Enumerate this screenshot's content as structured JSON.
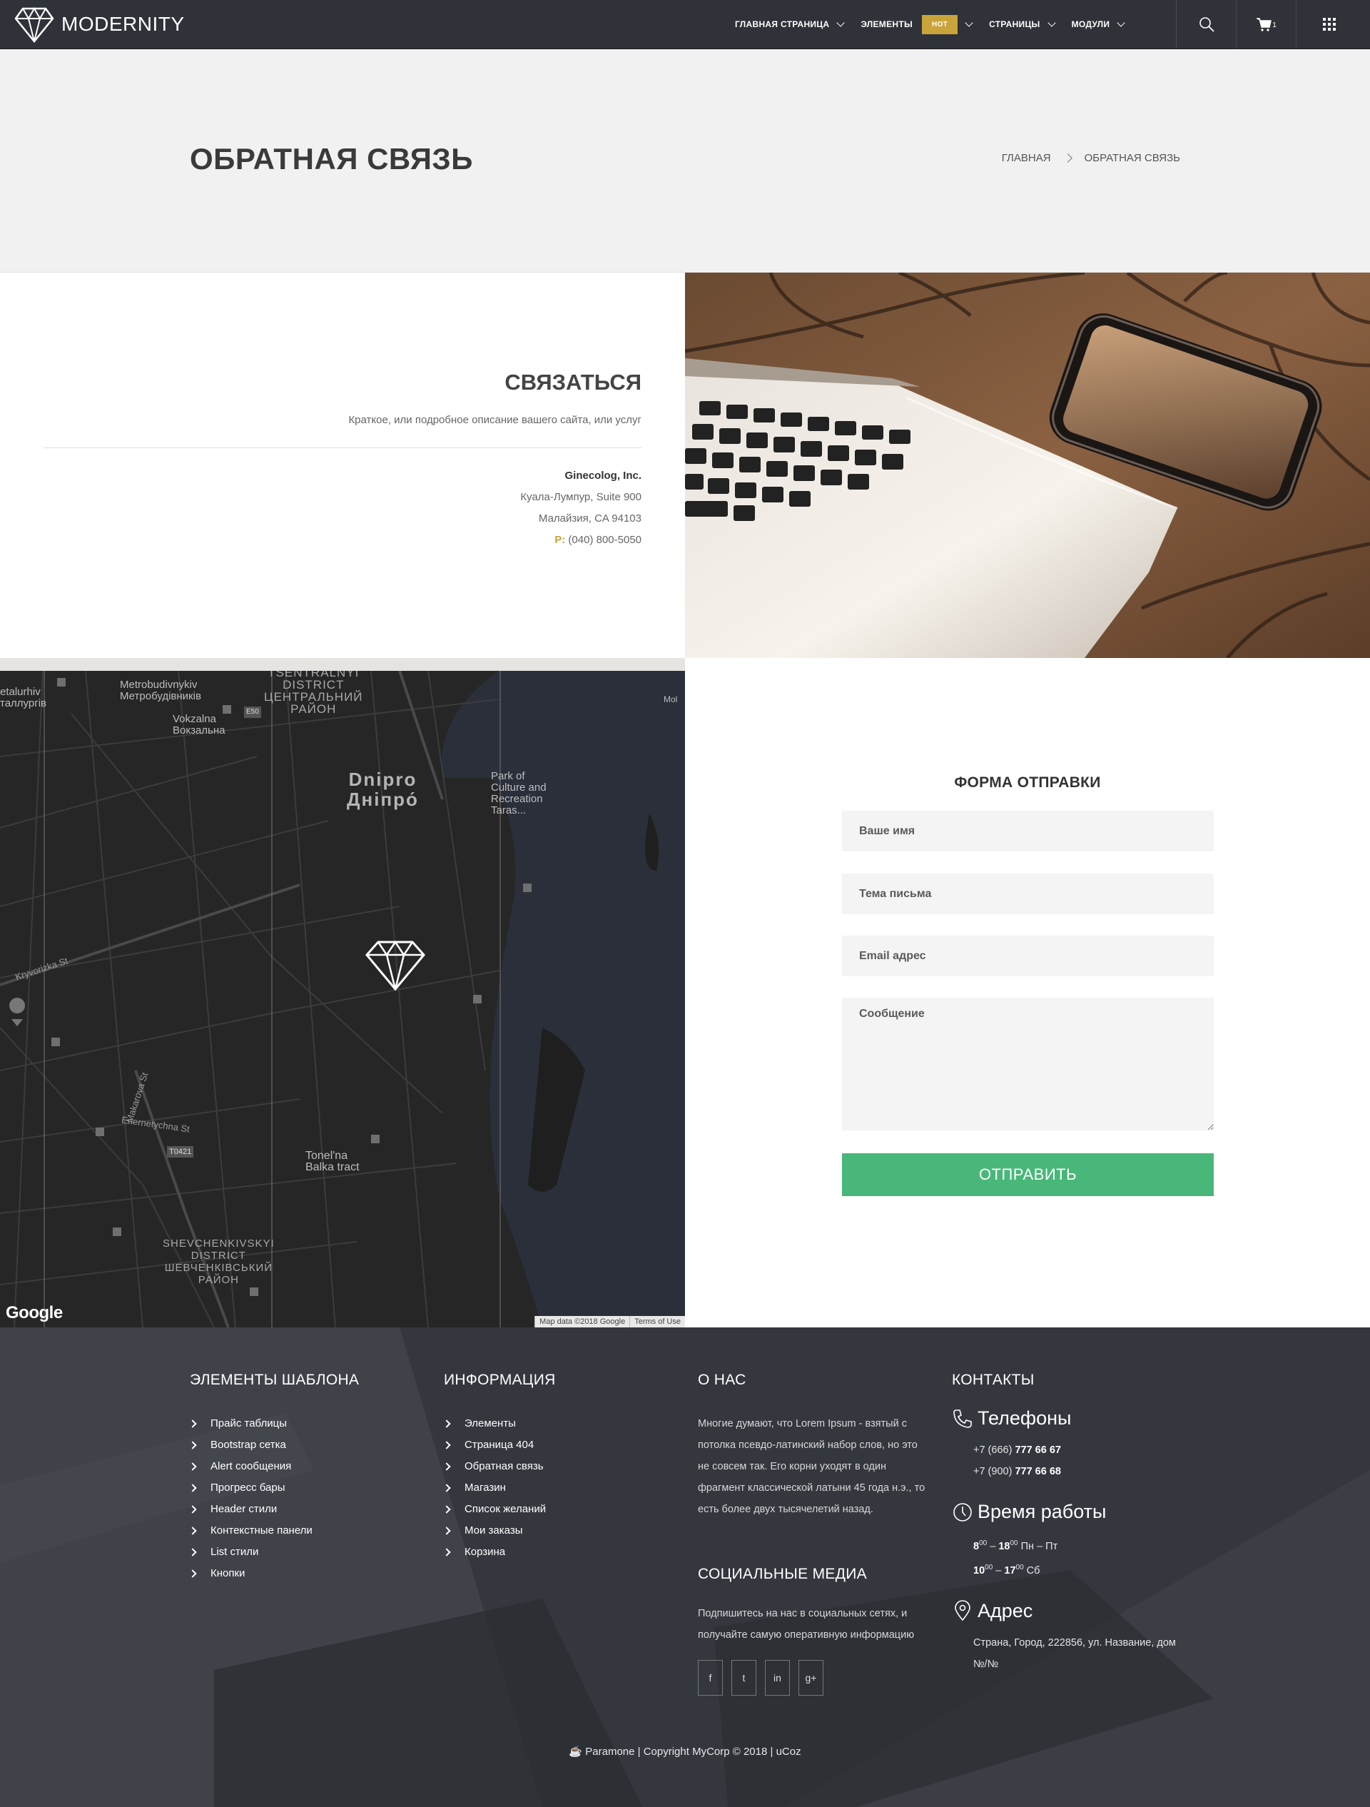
{
  "header": {
    "logo_text": "MODERNITY",
    "nav": [
      {
        "label": "ГЛАВНАЯ СТРАНИЦА"
      },
      {
        "label": "ЭЛЕМЕНТЫ",
        "badge": "HOT"
      },
      {
        "label": "СТРАНИЦЫ"
      },
      {
        "label": "МОДУЛИ"
      }
    ],
    "cart_count": "1",
    "icons": [
      "search-icon",
      "cart-icon",
      "grid-menu-icon"
    ]
  },
  "titlebar": {
    "title": "ОБРАТНАЯ СВЯЗЬ",
    "breadcrumb": [
      "ГЛАВНАЯ",
      "ОБРАТНАЯ СВЯЗЬ"
    ]
  },
  "contact": {
    "heading": "СВЯЗАТЬСЯ",
    "description": "Краткое, или подробное описание вашего сайта, или услуг",
    "company": "Ginecolog, Inc.",
    "address1": "Куала-Лумпур, Suite 900",
    "address2": "Малайзия, CA 94103",
    "phone_prefix": "P:",
    "phone": "(040) 800-5050"
  },
  "map": {
    "labels": {
      "district_top_1": "TSENTRALNYI",
      "district_top_2": "DISTRICT",
      "district_top_3": "ЦЕНТРАЛЬНИЙ",
      "district_top_4": "РАЙОН",
      "city_1": "Dnipro",
      "city_2": "Дніпро́",
      "park_1": "Park of",
      "park_2": "Culture and",
      "park_3": "Recreation",
      "park_4": "Taras...",
      "metro_1": "Metrobudivnykiv",
      "metro_2": "Метробудівників",
      "vokzal_1": "Vokzalna",
      "vokzal_2": "Вокзальна",
      "metall_1": "etalurhiv",
      "metall_2": "таллургів",
      "tonel_1": "Tonel'na",
      "tonel_2": "Balka tract",
      "shev_1": "SHEVCHENKIVSKYI",
      "shev_2": "DISTRICT",
      "shev_3": "ШЕВЧЕНКІВСЬКИЙ",
      "shev_4": "РАЙОН",
      "street_kryvorizka": "Kryvorizka St",
      "street_makarova": "Makarova St",
      "street_enernetychna": "Enernetychna St",
      "road_t0421": "T0421",
      "road_e50": "E50",
      "mol": "Mol"
    },
    "google": "Google",
    "attribution": [
      "Map data ©2018 Google",
      "Terms of Use"
    ]
  },
  "form": {
    "title": "ФОРМА ОТПРАВКИ",
    "name_placeholder": "Ваше имя",
    "subject_placeholder": "Тема письма",
    "email_placeholder": "Email адрес",
    "message_placeholder": "Сообщение",
    "submit_label": "ОТПРАВИТЬ"
  },
  "footer": {
    "col1": {
      "title": "ЭЛЕМЕНТЫ ШАБЛОНА",
      "items": [
        "Прайс таблицы",
        "Bootstrap сетка",
        "Alert сообщения",
        "Прогресс бары",
        "Header стили",
        "Контекстные панели",
        "List стили",
        "Кнопки"
      ]
    },
    "col2": {
      "title": "ИНФОРМАЦИЯ",
      "items": [
        "Элементы",
        "Страница 404",
        "Обратная связь",
        "Магазин",
        "Список желаний",
        "Мои заказы",
        "Корзина"
      ]
    },
    "col3": {
      "title": "О НАС",
      "text": "Многие думают, что Lorem Ipsum - взятый с потолка псевдо-латинский набор слов, но это не совсем так. Его корни уходят в один фрагмент классической латыни 45 года н.э., то есть более двух тысячелетий назад.",
      "social_title": "СОЦИАЛЬНЫЕ МЕДИА",
      "social_text": "Подпишитесь на нас в социальных сетях, и получайте самую оперативную информацию",
      "social_buttons": [
        "f",
        "t",
        "in",
        "g+"
      ]
    },
    "col4": {
      "title": "КОНТАКТЫ",
      "phones_title": "Телефоны",
      "phone1_prefix": "+7 (666) ",
      "phone1_bold": "777 66 67",
      "phone2_prefix": "+7 (900) ",
      "phone2_bold": "777 66 68",
      "hours_title": "Время работы",
      "hours1_from": "8",
      "hours1_from_min": "00",
      "hours1_sep": " – ",
      "hours1_to": "18",
      "hours1_to_min": "00",
      "hours1_days": " Пн – Пт",
      "hours2_from": "10",
      "hours2_from_min": "00",
      "hours2_sep": " – ",
      "hours2_to": "17",
      "hours2_to_min": "00",
      "hours2_days": " Сб",
      "address_title": "Адрес",
      "address_text": "Страна, Город, 222856, ул. Название, дом №/№"
    },
    "copyright": "Paramone | Copyright MyCorp © 2018 | uCoz",
    "copyright_icon": "☕"
  },
  "colors": {
    "header_bg": "#2f3238",
    "hot_badge": "#c9a43a",
    "submit": "#48b779",
    "footer_bg": "#3a3d44"
  }
}
